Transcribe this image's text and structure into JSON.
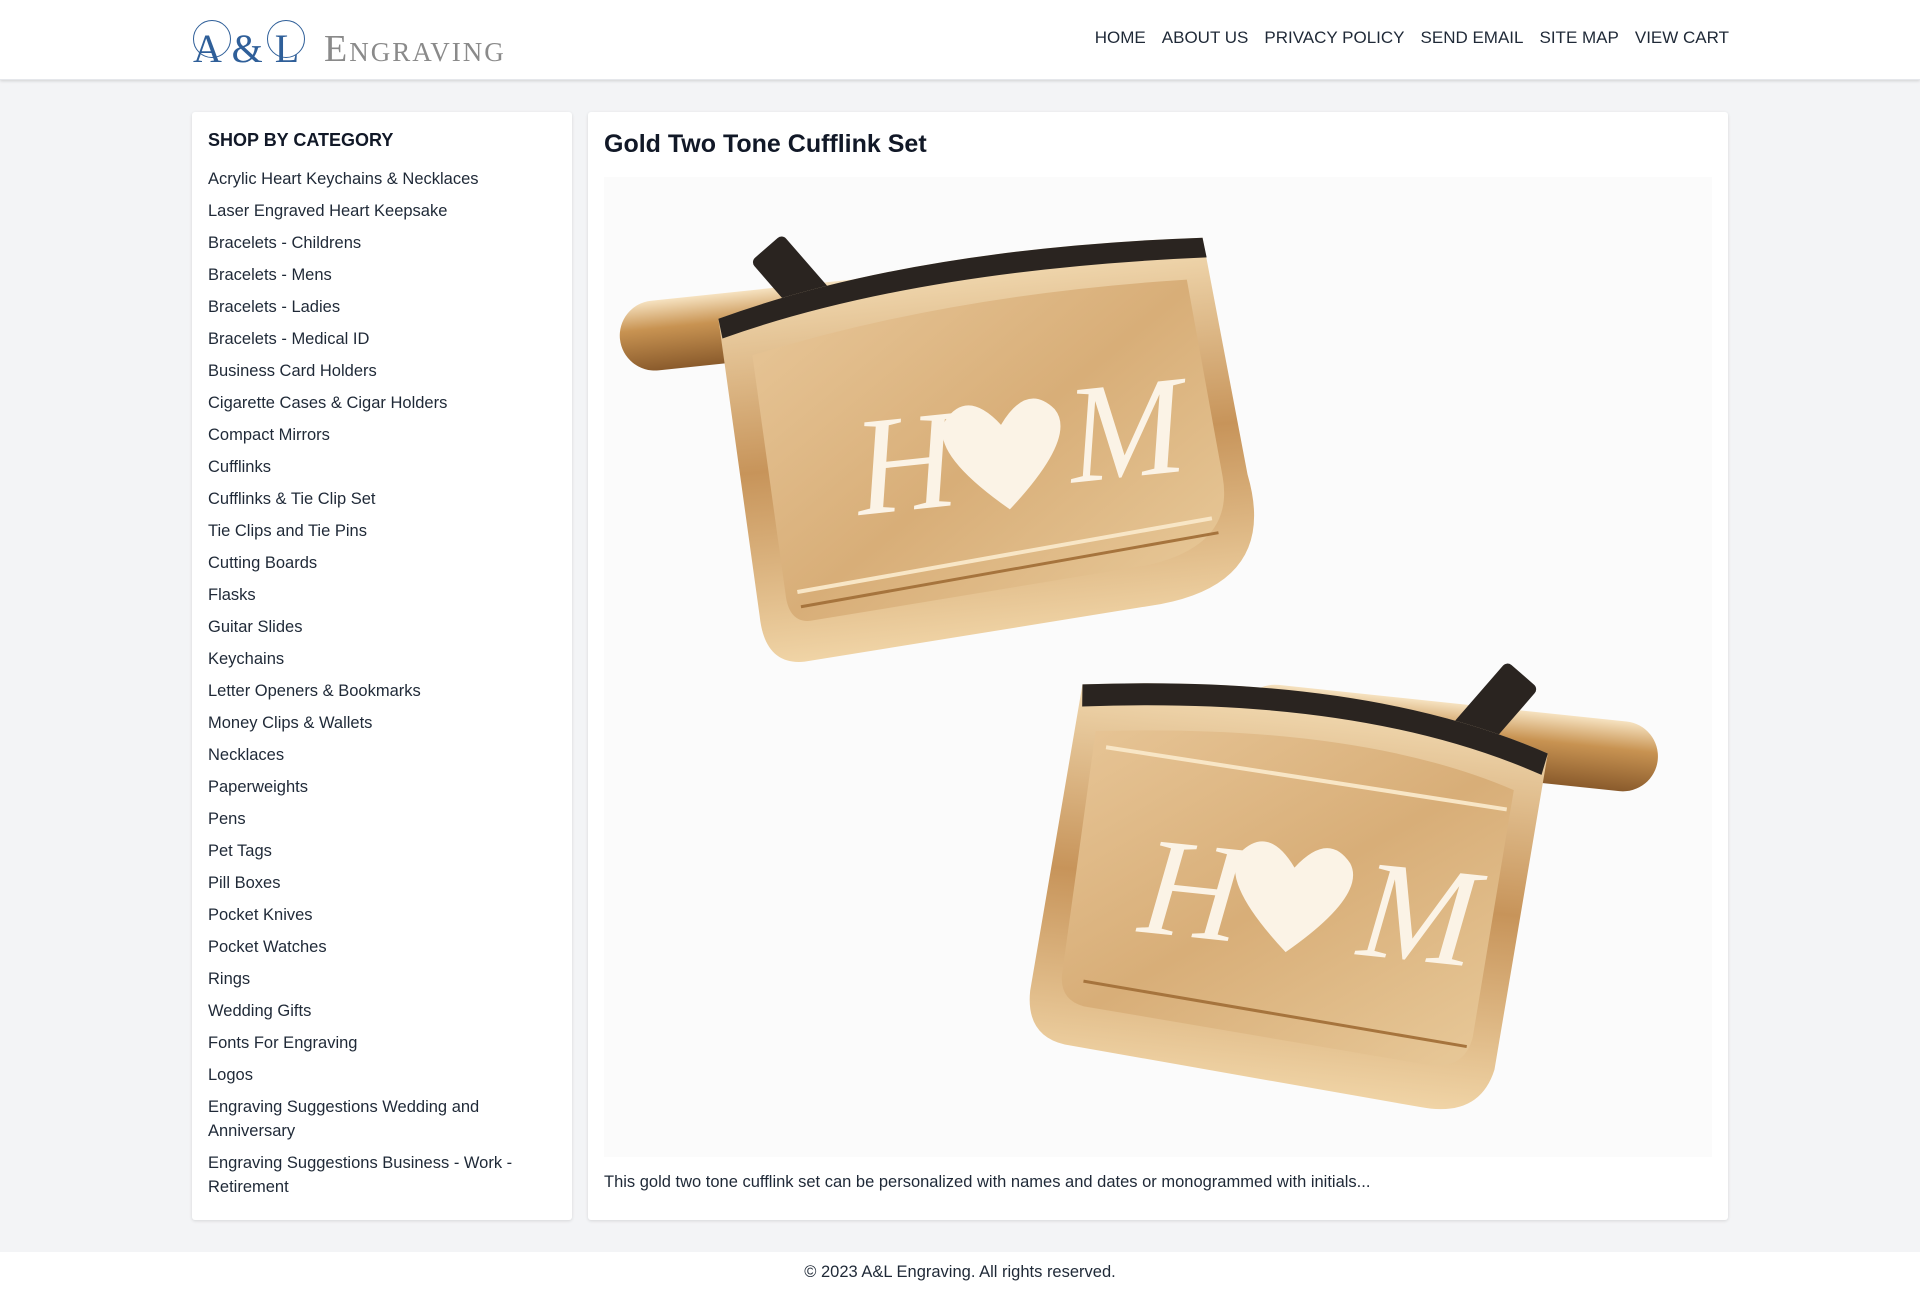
{
  "brand": {
    "logo_letters": "A & L",
    "logo_word": "Engraving"
  },
  "nav": {
    "items": [
      "HOME",
      "ABOUT US",
      "PRIVACY POLICY",
      "SEND EMAIL",
      "SITE MAP",
      "VIEW CART"
    ]
  },
  "sidebar": {
    "title": "SHOP BY CATEGORY",
    "categories": [
      "Acrylic Heart Keychains & Necklaces",
      "Laser Engraved Heart Keepsake",
      "Bracelets - Childrens",
      "Bracelets - Mens",
      "Bracelets - Ladies",
      "Bracelets - Medical ID",
      "Business Card Holders",
      "Cigarette Cases & Cigar Holders",
      "Compact Mirrors",
      "Cufflinks",
      "Cufflinks & Tie Clip Set",
      "Tie Clips and Tie Pins",
      "Cutting Boards",
      "Flasks",
      "Guitar Slides",
      "Keychains",
      "Letter Openers & Bookmarks",
      "Money Clips & Wallets",
      "Necklaces",
      "Paperweights",
      "Pens",
      "Pet Tags",
      "Pill Boxes",
      "Pocket Knives",
      "Pocket Watches",
      "Rings",
      "Wedding Gifts",
      "Fonts For Engraving",
      "Logos",
      "Engraving Suggestions Wedding and Anniversary",
      "Engraving Suggestions Business - Work - Retirement"
    ]
  },
  "product": {
    "title": "Gold Two Tone Cufflink Set",
    "engraving_left": "H",
    "engraving_right": "M",
    "description": "This gold two tone cufflink set can be personalized with names and dates or monogrammed with initials..."
  },
  "footer": {
    "copyright": "© 2023 A&L Engraving. All rights reserved."
  },
  "colors": {
    "logo_blue": "#2f5f99",
    "gold": "#d9b07a",
    "page_bg": "#f3f4f6"
  }
}
